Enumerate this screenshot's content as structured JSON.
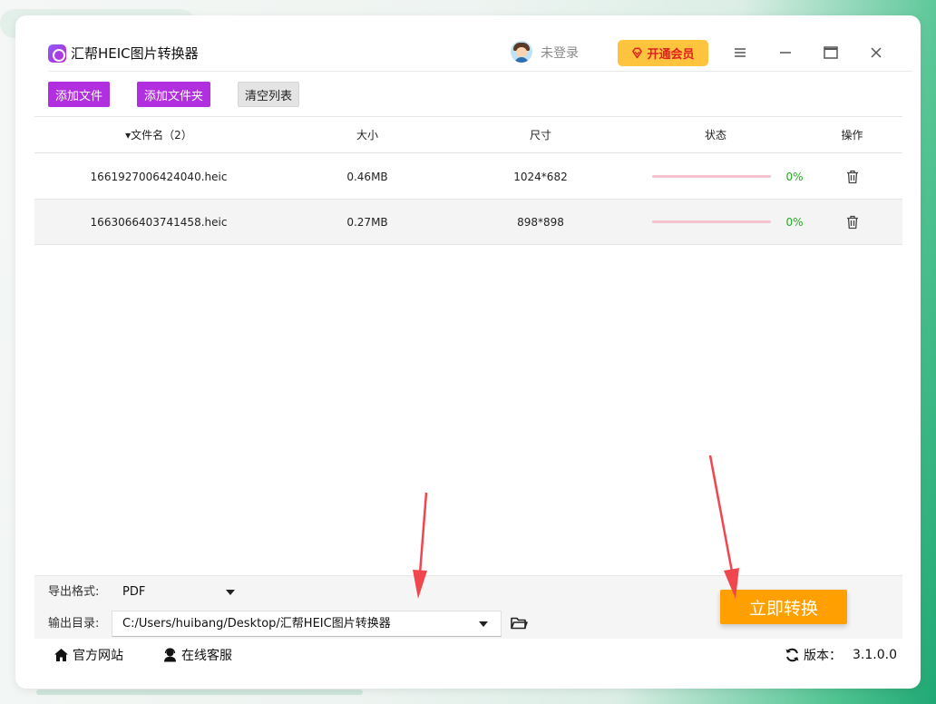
{
  "app": {
    "title": "汇帮HEIC图片转换器",
    "login_text": "未登录",
    "vip_label": "开通会员"
  },
  "toolbar": {
    "add_file": "添加文件",
    "add_folder": "添加文件夹",
    "clear_list": "清空列表"
  },
  "table": {
    "headers": {
      "name": "▾文件名（2）",
      "size": "大小",
      "dimensions": "尺寸",
      "status": "状态",
      "action": "操作"
    },
    "rows": [
      {
        "name": "1661927006424040.heic",
        "size": "0.46MB",
        "dimensions": "1024*682",
        "progress_text": "0%",
        "progress": 0
      },
      {
        "name": "1663066403741458.heic",
        "size": "0.27MB",
        "dimensions": "898*898",
        "progress_text": "0%",
        "progress": 0
      }
    ]
  },
  "settings": {
    "format_label": "导出格式:",
    "format_value": "PDF",
    "dir_label": "输出目录:",
    "dir_value": "C:/Users/huibang/Desktop/汇帮HEIC图片转换器"
  },
  "convert_label": "立即转换",
  "footer": {
    "website": "官方网站",
    "service": "在线客服",
    "version_label": "版本：",
    "version_value": "3.1.0.0"
  },
  "colors": {
    "accent_purple": "#b22fe0",
    "convert_orange": "#ff9f00",
    "vip_yellow": "#ffc43d",
    "vip_red": "#e02020",
    "progress_pink": "#f5c2d0",
    "progress_text_green": "#22a822",
    "annotation_red": "#f0464e"
  }
}
